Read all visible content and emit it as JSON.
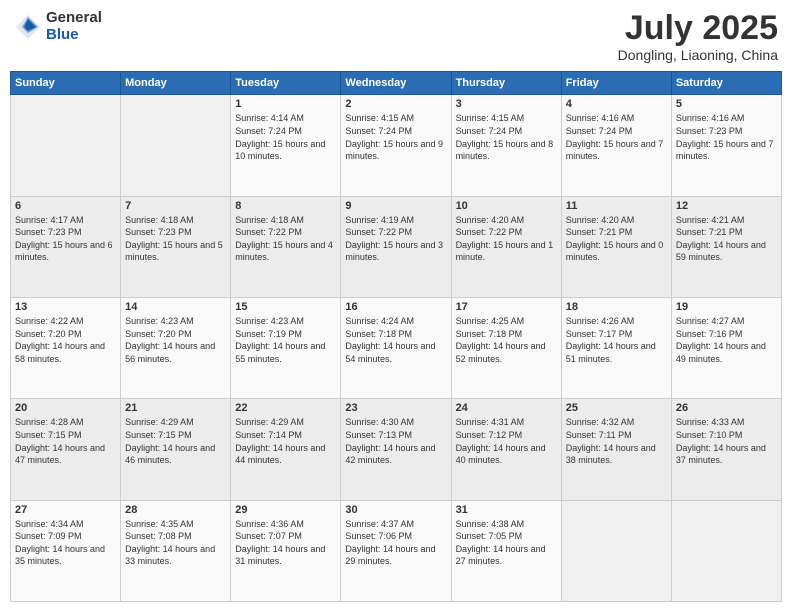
{
  "header": {
    "logo_general": "General",
    "logo_blue": "Blue",
    "month_year": "July 2025",
    "location": "Dongling, Liaoning, China"
  },
  "days_of_week": [
    "Sunday",
    "Monday",
    "Tuesday",
    "Wednesday",
    "Thursday",
    "Friday",
    "Saturday"
  ],
  "weeks": [
    [
      {
        "day": "",
        "info": ""
      },
      {
        "day": "",
        "info": ""
      },
      {
        "day": "1",
        "info": "Sunrise: 4:14 AM\nSunset: 7:24 PM\nDaylight: 15 hours and 10 minutes."
      },
      {
        "day": "2",
        "info": "Sunrise: 4:15 AM\nSunset: 7:24 PM\nDaylight: 15 hours and 9 minutes."
      },
      {
        "day": "3",
        "info": "Sunrise: 4:15 AM\nSunset: 7:24 PM\nDaylight: 15 hours and 8 minutes."
      },
      {
        "day": "4",
        "info": "Sunrise: 4:16 AM\nSunset: 7:24 PM\nDaylight: 15 hours and 7 minutes."
      },
      {
        "day": "5",
        "info": "Sunrise: 4:16 AM\nSunset: 7:23 PM\nDaylight: 15 hours and 7 minutes."
      }
    ],
    [
      {
        "day": "6",
        "info": "Sunrise: 4:17 AM\nSunset: 7:23 PM\nDaylight: 15 hours and 6 minutes."
      },
      {
        "day": "7",
        "info": "Sunrise: 4:18 AM\nSunset: 7:23 PM\nDaylight: 15 hours and 5 minutes."
      },
      {
        "day": "8",
        "info": "Sunrise: 4:18 AM\nSunset: 7:22 PM\nDaylight: 15 hours and 4 minutes."
      },
      {
        "day": "9",
        "info": "Sunrise: 4:19 AM\nSunset: 7:22 PM\nDaylight: 15 hours and 3 minutes."
      },
      {
        "day": "10",
        "info": "Sunrise: 4:20 AM\nSunset: 7:22 PM\nDaylight: 15 hours and 1 minute."
      },
      {
        "day": "11",
        "info": "Sunrise: 4:20 AM\nSunset: 7:21 PM\nDaylight: 15 hours and 0 minutes."
      },
      {
        "day": "12",
        "info": "Sunrise: 4:21 AM\nSunset: 7:21 PM\nDaylight: 14 hours and 59 minutes."
      }
    ],
    [
      {
        "day": "13",
        "info": "Sunrise: 4:22 AM\nSunset: 7:20 PM\nDaylight: 14 hours and 58 minutes."
      },
      {
        "day": "14",
        "info": "Sunrise: 4:23 AM\nSunset: 7:20 PM\nDaylight: 14 hours and 56 minutes."
      },
      {
        "day": "15",
        "info": "Sunrise: 4:23 AM\nSunset: 7:19 PM\nDaylight: 14 hours and 55 minutes."
      },
      {
        "day": "16",
        "info": "Sunrise: 4:24 AM\nSunset: 7:18 PM\nDaylight: 14 hours and 54 minutes."
      },
      {
        "day": "17",
        "info": "Sunrise: 4:25 AM\nSunset: 7:18 PM\nDaylight: 14 hours and 52 minutes."
      },
      {
        "day": "18",
        "info": "Sunrise: 4:26 AM\nSunset: 7:17 PM\nDaylight: 14 hours and 51 minutes."
      },
      {
        "day": "19",
        "info": "Sunrise: 4:27 AM\nSunset: 7:16 PM\nDaylight: 14 hours and 49 minutes."
      }
    ],
    [
      {
        "day": "20",
        "info": "Sunrise: 4:28 AM\nSunset: 7:15 PM\nDaylight: 14 hours and 47 minutes."
      },
      {
        "day": "21",
        "info": "Sunrise: 4:29 AM\nSunset: 7:15 PM\nDaylight: 14 hours and 46 minutes."
      },
      {
        "day": "22",
        "info": "Sunrise: 4:29 AM\nSunset: 7:14 PM\nDaylight: 14 hours and 44 minutes."
      },
      {
        "day": "23",
        "info": "Sunrise: 4:30 AM\nSunset: 7:13 PM\nDaylight: 14 hours and 42 minutes."
      },
      {
        "day": "24",
        "info": "Sunrise: 4:31 AM\nSunset: 7:12 PM\nDaylight: 14 hours and 40 minutes."
      },
      {
        "day": "25",
        "info": "Sunrise: 4:32 AM\nSunset: 7:11 PM\nDaylight: 14 hours and 38 minutes."
      },
      {
        "day": "26",
        "info": "Sunrise: 4:33 AM\nSunset: 7:10 PM\nDaylight: 14 hours and 37 minutes."
      }
    ],
    [
      {
        "day": "27",
        "info": "Sunrise: 4:34 AM\nSunset: 7:09 PM\nDaylight: 14 hours and 35 minutes."
      },
      {
        "day": "28",
        "info": "Sunrise: 4:35 AM\nSunset: 7:08 PM\nDaylight: 14 hours and 33 minutes."
      },
      {
        "day": "29",
        "info": "Sunrise: 4:36 AM\nSunset: 7:07 PM\nDaylight: 14 hours and 31 minutes."
      },
      {
        "day": "30",
        "info": "Sunrise: 4:37 AM\nSunset: 7:06 PM\nDaylight: 14 hours and 29 minutes."
      },
      {
        "day": "31",
        "info": "Sunrise: 4:38 AM\nSunset: 7:05 PM\nDaylight: 14 hours and 27 minutes."
      },
      {
        "day": "",
        "info": ""
      },
      {
        "day": "",
        "info": ""
      }
    ]
  ]
}
